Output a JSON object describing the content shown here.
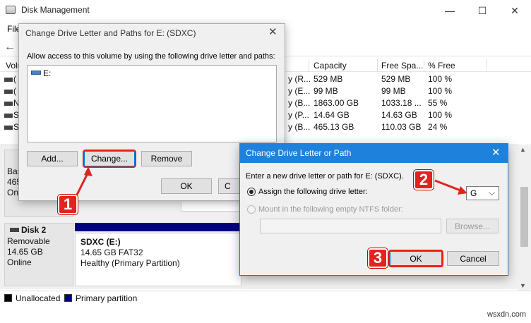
{
  "app": {
    "title": "Disk Management",
    "menu_file": "File",
    "win_minimize": "—",
    "win_maximize": "☐",
    "win_close": "✕",
    "back_icon": "←"
  },
  "volume_list": {
    "headers": {
      "volume": "Volume",
      "capacity": "Capacity",
      "free_space": "Free Spa...",
      "pct_free": "% Free"
    },
    "rows": [
      {
        "vol_initial": "(",
        "fs": "y (R...",
        "capacity": "529 MB",
        "free": "529 MB",
        "pct": "100 %"
      },
      {
        "vol_initial": "(",
        "fs": "y (E...",
        "capacity": "99 MB",
        "free": "99 MB",
        "pct": "100 %"
      },
      {
        "vol_initial": "N",
        "fs": "y (B...",
        "capacity": "1863.00 GB",
        "free": "1033.18 ...",
        "pct": "55 %"
      },
      {
        "vol_initial": "S",
        "fs": "y (P...",
        "capacity": "14.64 GB",
        "free": "14.63 GB",
        "pct": "100 %"
      },
      {
        "vol_initial": "S",
        "fs": "y (B...",
        "capacity": "465.13 GB",
        "free": "110.03 GB",
        "pct": "24 %"
      }
    ]
  },
  "disk_map": {
    "left_frag_1": "Bas",
    "left_frag_2": "465",
    "left_frag_3": "On",
    "disk2_name": "Disk 2",
    "disk2_type": "Removable",
    "disk2_size": "14.65 GB",
    "disk2_status": "Online",
    "partition_name": "SDXC  (E:)",
    "partition_size": "14.65 GB FAT32",
    "partition_health": "Healthy (Primary Partition)"
  },
  "legend": {
    "unallocated": "Unallocated",
    "primary": "Primary partition",
    "unallocated_color": "#000000",
    "primary_color": "#000080"
  },
  "dialog_paths": {
    "title": "Change Drive Letter and Paths for E: (SDXC)",
    "close": "✕",
    "description": "Allow access to this volume by using the following drive letter and paths:",
    "entries": [
      "E:"
    ],
    "add": "Add...",
    "change": "Change...",
    "remove": "Remove",
    "ok": "OK",
    "cancel_partial": "C"
  },
  "dialog_letter": {
    "title": "Change Drive Letter or Path",
    "close": "✕",
    "prompt": "Enter a new drive letter or path for E: (SDXC).",
    "option_assign": "Assign the following drive letter:",
    "option_mount": "Mount in the following empty NTFS folder:",
    "selected_letter": "G",
    "dropdown_icon": "⌵",
    "browse": "Browse...",
    "ok": "OK",
    "cancel": "Cancel"
  },
  "annotations": {
    "step1": "1",
    "step2": "2",
    "step3": "3",
    "color": "#e1241e"
  },
  "watermark": "wsxdn.com"
}
